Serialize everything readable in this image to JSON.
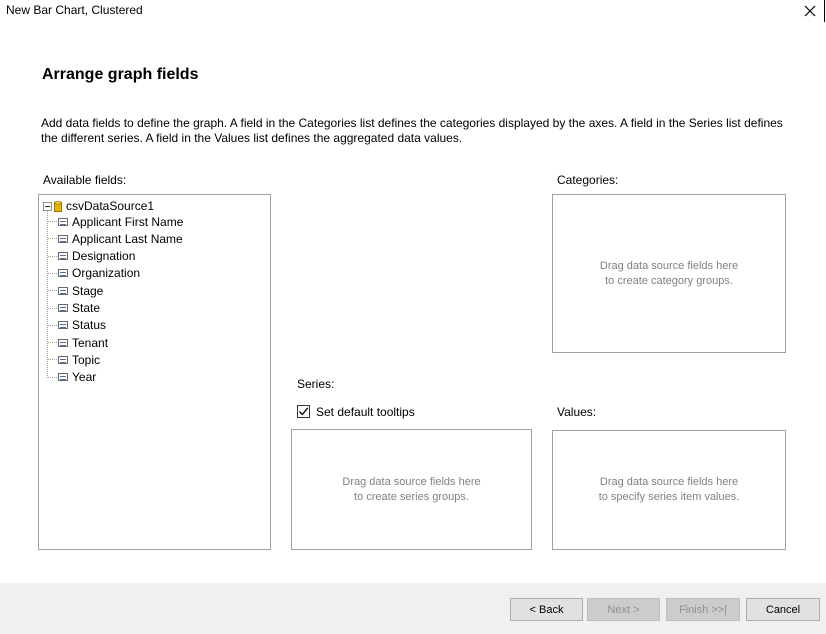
{
  "window": {
    "title": "New Bar Chart, Clustered"
  },
  "page": {
    "heading": "Arrange graph fields",
    "description": "Add data fields to define the graph. A field in the Categories list defines the categories displayed by the axes. A field in the Series list defines the different series. A field in the Values list defines the aggregated data values."
  },
  "available": {
    "label": "Available fields:",
    "datasource": "csvDataSource1",
    "fields": [
      {
        "label": "Applicant First Name"
      },
      {
        "label": "Applicant Last Name"
      },
      {
        "label": "Designation"
      },
      {
        "label": "Organization"
      },
      {
        "label": "Stage"
      },
      {
        "label": "State"
      },
      {
        "label": "Status"
      },
      {
        "label": "Tenant"
      },
      {
        "label": "Topic"
      },
      {
        "label": "Year"
      }
    ]
  },
  "categories": {
    "label": "Categories:",
    "hint_line1": "Drag data source fields here",
    "hint_line2": "to create category groups."
  },
  "series": {
    "label": "Series:",
    "tooltips_label": "Set default tooltips",
    "tooltips_checked": true,
    "hint_line1": "Drag data source fields here",
    "hint_line2": "to create series groups."
  },
  "values": {
    "label": "Values:",
    "hint_line1": "Drag data source fields here",
    "hint_line2": "to specify series item values."
  },
  "buttons": {
    "back": "< Back",
    "next": "Next >",
    "finish": "Finish >>|",
    "cancel": "Cancel"
  }
}
